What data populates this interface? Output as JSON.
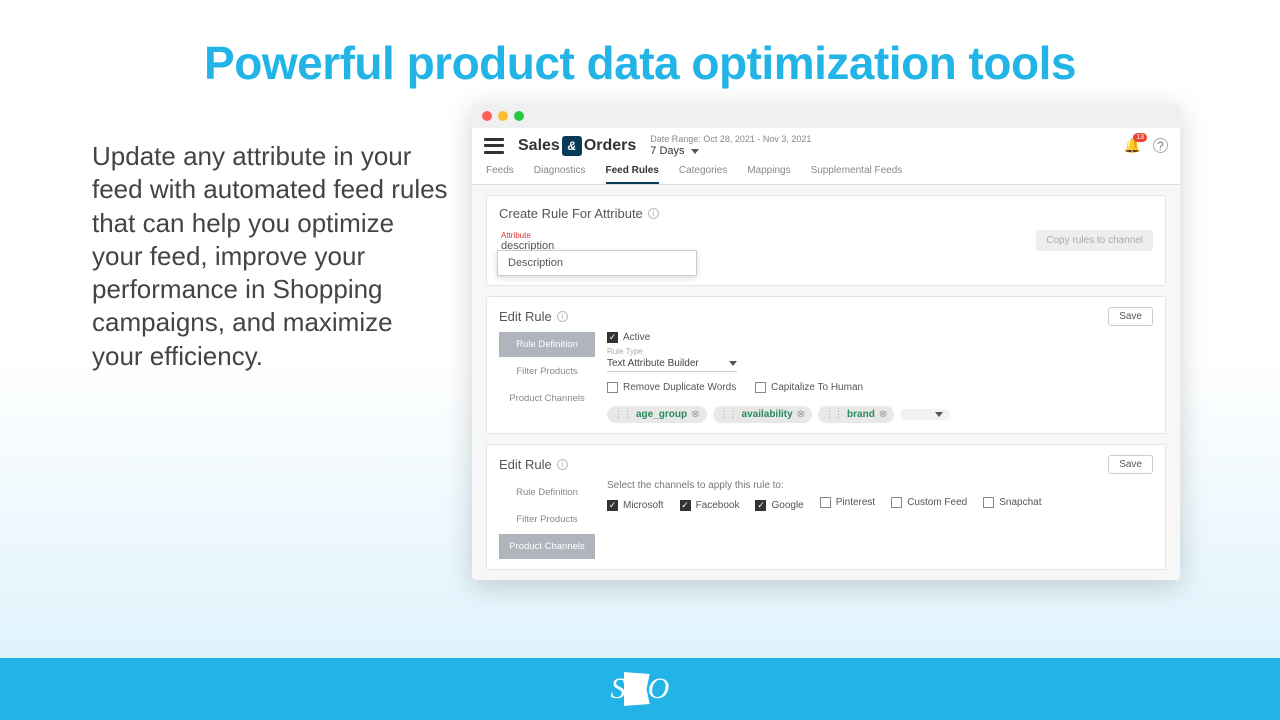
{
  "hero_title": "Powerful product data optimization tools",
  "blurb": "Update any attribute in your feed with automated feed rules that can help you optimize your feed, improve your performance in Shopping campaigns, and maximize your efficiency.",
  "app": {
    "brand_left": "Sales",
    "brand_right": "Orders",
    "date_range_label": "Date Range: Oct 28, 2021 - Nov 3, 2021",
    "range_sel": "7 Days",
    "notif_count": "13"
  },
  "tabs": [
    "Feeds",
    "Diagnostics",
    "Feed Rules",
    "Categories",
    "Mappings",
    "Supplemental Feeds"
  ],
  "active_tab": 2,
  "create": {
    "title": "Create Rule For Attribute",
    "attr_label": "Attribute",
    "attr_value": "description",
    "dropdown_option": "Description",
    "copy_btn": "Copy rules to channel"
  },
  "rule1": {
    "title": "Edit Rule",
    "save": "Save",
    "sidetabs": [
      "Rule Definition",
      "Filter Products",
      "Product Channels"
    ],
    "active_side": 0,
    "active_label": "Active",
    "rule_type_label": "Rule Type",
    "rule_type_value": "Text Attribute Builder",
    "opt_remove": "Remove Duplicate Words",
    "opt_cap": "Capitalize To Human",
    "chips": [
      "age_group",
      "availability",
      "brand"
    ]
  },
  "rule2": {
    "title": "Edit Rule",
    "save": "Save",
    "sidetabs": [
      "Rule Definition",
      "Filter Products",
      "Product Channels"
    ],
    "active_side": 2,
    "instructions": "Select the channels to apply this rule to:",
    "channels": [
      {
        "name": "Microsoft",
        "on": true
      },
      {
        "name": "Facebook",
        "on": true
      },
      {
        "name": "Google",
        "on": true
      },
      {
        "name": "Pinterest",
        "on": false
      },
      {
        "name": "Custom Feed",
        "on": false
      },
      {
        "name": "Snapchat",
        "on": false
      }
    ]
  },
  "footer": {
    "left": "S",
    "amp": "&",
    "right": "O"
  }
}
